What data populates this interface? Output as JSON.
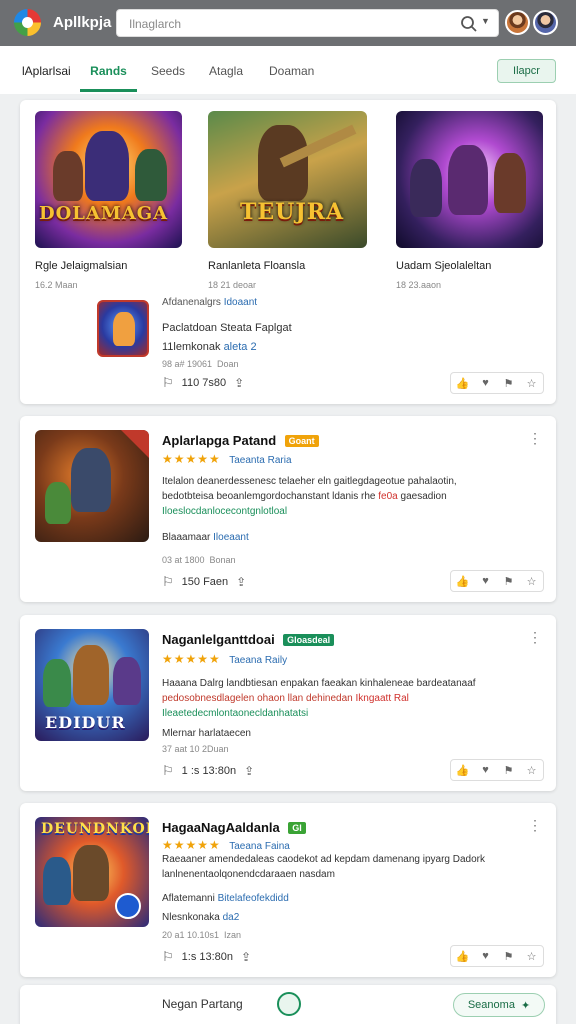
{
  "header": {
    "app_title": "Apllkpja",
    "search_placeholder": "Ilnaglarch"
  },
  "tabs": [
    {
      "label": "lAplarlsai"
    },
    {
      "label": "Rands"
    },
    {
      "label": "Seeds"
    },
    {
      "label": "Atagla"
    },
    {
      "label": "Doaman"
    }
  ],
  "report_button": "Ilapcr",
  "featured": {
    "games": [
      {
        "cover_text": "DOLAMAGA",
        "title": "Rgle Jelaigmalsian",
        "meta": "16.2 Maan"
      },
      {
        "cover_text": "TEUJRA",
        "title": "Ranlanleta Floansla",
        "meta": "18 21 deoar"
      },
      {
        "cover_text": "",
        "title": "Uadam Sjeolaleltan",
        "meta": "18 23.aaon"
      }
    ],
    "sub": {
      "publisher_prefix": "Afdanenalgrs",
      "publisher_link": "Idoaant",
      "line2": "Paclatdoan Steata Faplgat",
      "line3_prefix": "11lemkonak",
      "line3_highlight": "aleta 2",
      "line4": "98 a# 19061  Doan",
      "count": "110 7s80"
    }
  },
  "listings": [
    {
      "title": "Aplarlapga Patand",
      "badge": "Goant",
      "badge_color": "#f0a30a",
      "rating_text": "Taeanta Raria",
      "desc1": "Itelalon deanerdessenesc telaeher eln gaitlegdageotue pahalaotin,",
      "desc2_prefix": "bedotbteisa beoanlemgordochanstant ldanis rhe",
      "desc2_red": "fe0a",
      "desc2_suffix": "gaesadion",
      "desc3": "Iloeslocdanlocecontgnlotloal",
      "pub_prefix": "Blaaamaar",
      "pub_link": "Iloeaant",
      "meta": "03 at 1800  Bonan",
      "count": "150 Faen"
    },
    {
      "title": "Naganlelganttdoai",
      "badge": "Gloasdeal",
      "badge_color": "#1a8f5a",
      "rating_text": "Taeana Raily",
      "desc1": "Haaana Dalrg landbtiesan enpakan faeakan kinhaleneae bardeatanaaf",
      "desc2_prefix": "pedosobnesdlagelen ohaon llan dehinedan",
      "desc2_red": "Ikngaatt Ral",
      "desc2_suffix": "",
      "desc3": "Ileaetedecmlontaonecldanhatatsi",
      "pub_prefix": "Mlernar harlataecen",
      "pub_link": "",
      "meta": "37 aat 10 2Duan",
      "count": "1 :s 13:80n"
    },
    {
      "title": "HagaaNagAaldanla",
      "badge": "Gl",
      "badge_color": "#3aa335",
      "rating_text": "Taeana Faina",
      "desc1": "Raeaaner amendedaleas caodekot ad kepdam damenang ipyarg Dadork",
      "desc2_prefix": "lanlnenentaolqonendcdaraaen nasdam",
      "desc2_red": "",
      "desc2_suffix": "",
      "desc3": "",
      "pub_prefix": "Aflatemanni",
      "pub_link": "Bitelafeofekdidd",
      "pub_line2_prefix": "Nlesnkonaka",
      "pub_line2_link": "da2",
      "meta": "20 a1 10.10s1  Izan",
      "count": "1:s 13:80n"
    }
  ],
  "bottom": {
    "title": "Negan Partang",
    "button": "Seanoma"
  }
}
